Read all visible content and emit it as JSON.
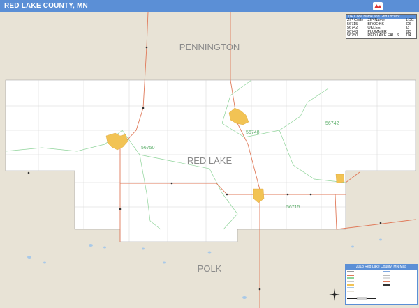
{
  "title": "RED LAKE COUNTY, MN",
  "counties": {
    "north": "PENNINGTON",
    "center": "RED LAKE",
    "south": "POLK"
  },
  "zip_labels": [
    "56748",
    "56742",
    "56750",
    "56715"
  ],
  "zip_table": {
    "header": "ZIP Code Name and Grid Locator",
    "columns": [
      "ZIP Code",
      "ZIP Name",
      "LOC"
    ],
    "rows": [
      [
        "56715",
        "BROOKS",
        "G6"
      ],
      [
        "56742",
        "OKLEE",
        "I3"
      ],
      [
        "56748",
        "PLUMMER",
        "G3"
      ],
      [
        "56750",
        "RED LAKE FALLS",
        "D4"
      ]
    ]
  },
  "legend": {
    "title": "2018 Red Lake County, MN Map"
  },
  "colors": {
    "title_bar": "#5b8fd6",
    "outside_county": "#e8e3d6",
    "county_land": "#ffffff",
    "water": "#a9c9e8",
    "city": "#f2c354",
    "zip_boundary": "#8fd49a",
    "road": "#e07a5a",
    "minor_road": "#c9c9c9"
  },
  "icons": [
    "compass-rose-icon",
    "logo-icon"
  ]
}
